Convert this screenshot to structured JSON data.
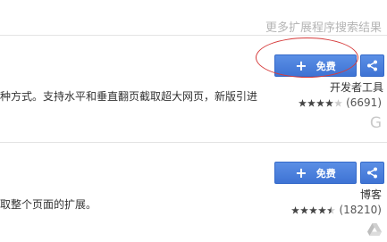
{
  "header": {
    "more_results_label": "更多扩展程序搜索结果"
  },
  "results": [
    {
      "description": "种方式。支持水平和垂直翻页截取超大网页，新版引进",
      "install_label": "免费",
      "category": "开发者工具",
      "rating_count": "(6691)",
      "stars": 4,
      "publisher_icon": "google-g-icon"
    },
    {
      "description": "取整个页面的扩展。",
      "install_label": "免费",
      "category": "博客",
      "rating_count": "(18210)",
      "stars": 4.5,
      "publisher_icon": "google-drive-icon"
    }
  ],
  "colors": {
    "button_blue": "#4a7fdd",
    "annotation_red": "#d63b3b",
    "star_dark": "#444444"
  }
}
